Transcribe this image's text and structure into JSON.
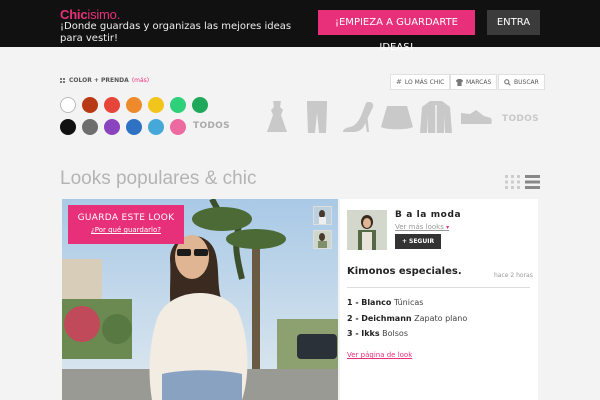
{
  "header": {
    "logo_part1": "Chic",
    "logo_part2": "isimo.",
    "tagline": "¡Donde guardas y organizas las mejores ideas para vestir!",
    "cta_label": "¡EMPIEZA A GUARDARTE IDEAS!",
    "login_label": "ENTRA"
  },
  "filters": {
    "title": "COLOR + PRENDA",
    "more_label": "(más)",
    "colors": [
      "#ffffff",
      "#b83a14",
      "#e6453a",
      "#ee8a2c",
      "#f2c51c",
      "#2fd07a",
      "#1fa85a",
      "#111111",
      "#6e6e6e",
      "#8a44bd",
      "#2f72c4",
      "#45a8d8",
      "#ec6aa0"
    ],
    "todos_colors": "TODOS",
    "categories": [
      "dress-icon",
      "pants-icon",
      "heels-icon",
      "skirt-icon",
      "jacket-icon",
      "sneaker-icon"
    ],
    "todos_categories": "TODOS",
    "pills": [
      {
        "label": "LO MÁS CHIC",
        "icon": "hash-icon"
      },
      {
        "label": "MARCAS",
        "icon": "shirt-icon"
      },
      {
        "label": "BUSCAR",
        "icon": "search-icon"
      }
    ]
  },
  "main": {
    "heading": "Looks populares & chic",
    "save_title": "GUARDA ESTE LOOK",
    "save_sub": "¿Por qué guardarlo?"
  },
  "look": {
    "user": "B a la moda",
    "more_looks": "Ver más looks",
    "follow_label": "SEGUIR",
    "title": "Kimonos especiales.",
    "time": "hace 2 horas",
    "items": [
      {
        "num": "1 -",
        "brand": "Blanco",
        "garment": "Túnicas"
      },
      {
        "num": "2 -",
        "brand": "Deichmann",
        "garment": "Zapato plano"
      },
      {
        "num": "3 -",
        "brand": "Ikks",
        "garment": "Bolsos"
      }
    ],
    "link": "Ver página de look"
  }
}
